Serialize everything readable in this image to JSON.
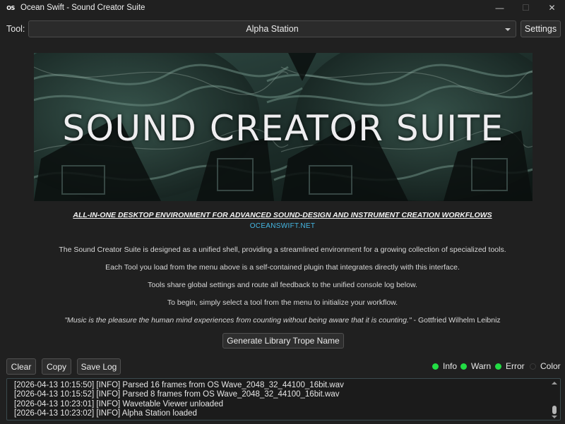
{
  "window": {
    "logo_text": "OS",
    "title": "Ocean Swift - Sound Creator Suite",
    "minimize_glyph": "—",
    "maximize_glyph": "☐",
    "close_glyph": "✕"
  },
  "toolbar": {
    "tool_label": "Tool:",
    "selected_tool": "Alpha Station",
    "settings_label": "Settings"
  },
  "banner": {
    "title": "SOUND CREATOR SUITE"
  },
  "intro": {
    "tagline": "ALL-IN-ONE DESKTOP ENVIRONMENT FOR ADVANCED SOUND-DESIGN AND INSTRUMENT CREATION WORKFLOWS",
    "website": "OCEANSWIFT.NET",
    "paragraphs": [
      "The Sound Creator Suite is designed as a unified shell, providing a streamlined environment for a growing collection of specialized tools.",
      "Each Tool you load from the menu above is a self-contained plugin that integrates directly with this interface.",
      "Tools share global settings and route all feedback to the unified console log below.",
      "To begin, simply select a tool from the menu to initialize your workflow."
    ],
    "quote_text": "\"Music is the pleasure the human mind experiences from counting without being aware that it is counting.\"",
    "quote_author": " - Gottfried Wilhelm Leibniz",
    "generate_button": "Generate Library Trope Name"
  },
  "log_toolbar": {
    "clear_label": "Clear",
    "copy_label": "Copy",
    "save_label": "Save Log",
    "filters": [
      {
        "label": "Info",
        "color": "#22dd44",
        "active": true
      },
      {
        "label": "Warn",
        "color": "#22dd44",
        "active": true
      },
      {
        "label": "Error",
        "color": "#22dd44",
        "active": true
      },
      {
        "label": "Color",
        "color": "#1e1e1e",
        "active": false
      }
    ]
  },
  "console": {
    "lines": [
      "[2026-04-13 10:15:50] [INFO] Parsed 16 frames from OS Wave_2048_32_44100_16bit.wav",
      "[2026-04-13 10:15:52] [INFO] Parsed 8 frames from OS Wave_2048_32_44100_16bit.wav",
      "[2026-04-13 10:23:01] [INFO] Wavetable Viewer unloaded",
      "[2026-04-13 10:23:02] [INFO] Alpha Station loaded"
    ]
  }
}
